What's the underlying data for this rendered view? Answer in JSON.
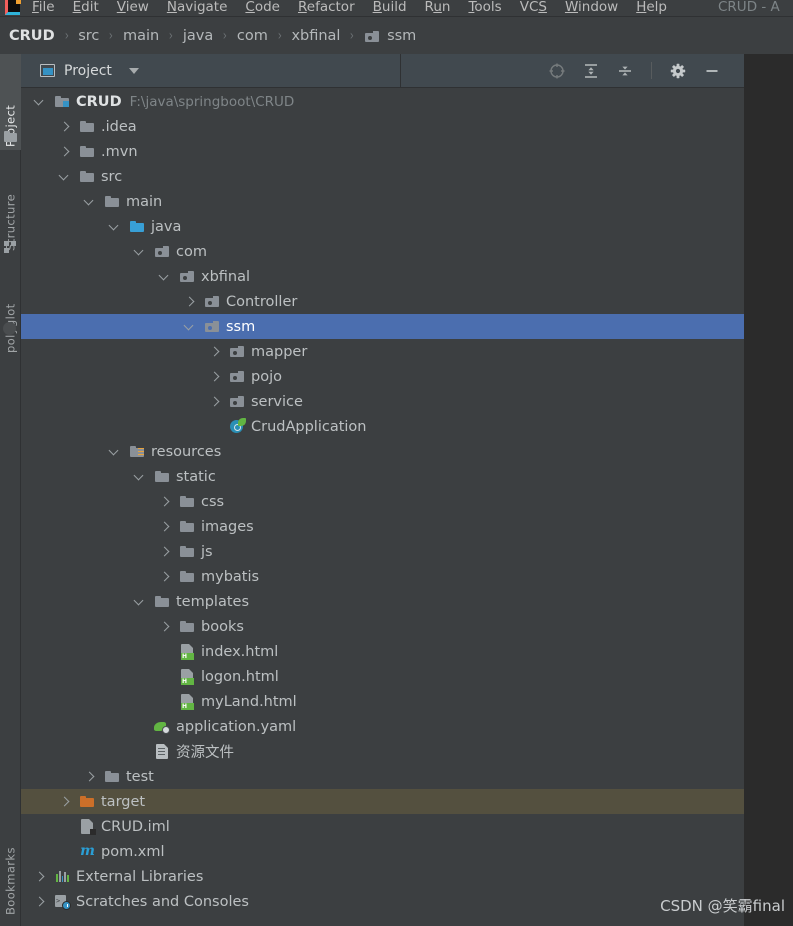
{
  "window": {
    "title": "CRUD - A",
    "app_icon": "intellij-idea-logo"
  },
  "menubar": {
    "items": [
      {
        "label": "File",
        "mnemonic": "F"
      },
      {
        "label": "Edit",
        "mnemonic": "E"
      },
      {
        "label": "View",
        "mnemonic": "V"
      },
      {
        "label": "Navigate",
        "mnemonic": "N"
      },
      {
        "label": "Code",
        "mnemonic": "C"
      },
      {
        "label": "Refactor",
        "mnemonic": "R"
      },
      {
        "label": "Build",
        "mnemonic": "B"
      },
      {
        "label": "Run",
        "mnemonic": "u"
      },
      {
        "label": "Tools",
        "mnemonic": "T"
      },
      {
        "label": "VCS",
        "mnemonic": "S"
      },
      {
        "label": "Window",
        "mnemonic": "W"
      },
      {
        "label": "Help",
        "mnemonic": "H"
      }
    ]
  },
  "breadcrumb": {
    "separator": "›",
    "items": [
      {
        "label": "CRUD",
        "icon": null
      },
      {
        "label": "src",
        "icon": null
      },
      {
        "label": "main",
        "icon": null
      },
      {
        "label": "java",
        "icon": null
      },
      {
        "label": "com",
        "icon": null
      },
      {
        "label": "xbfinal",
        "icon": null
      },
      {
        "label": "ssm",
        "icon": "package-icon"
      }
    ]
  },
  "toolstrip": {
    "left": [
      {
        "label": "Project",
        "icon": "folder-icon",
        "active": true
      },
      {
        "label": "Structure",
        "icon": "structure-icon",
        "active": false
      },
      {
        "label": "polyglot",
        "icon": "polyglot-icon",
        "active": false
      }
    ],
    "bottom": [
      {
        "label": "Bookmarks",
        "icon": "bookmarks-icon",
        "active": false
      }
    ]
  },
  "project_panel": {
    "title": "Project",
    "dropdown_icon": "chevron-down-icon",
    "view_icon": "tool-window-icon",
    "actions": [
      {
        "name": "select-opened-file",
        "icon": "locate-target-icon",
        "tooltip": "Select Opened File"
      },
      {
        "name": "expand-all",
        "icon": "expand-all-icon",
        "tooltip": "Expand All"
      },
      {
        "name": "collapse-all",
        "icon": "collapse-all-icon",
        "tooltip": "Collapse All"
      },
      {
        "name": "settings",
        "icon": "gear-icon",
        "tooltip": "Options"
      },
      {
        "name": "hide",
        "icon": "minimize-icon",
        "tooltip": "Hide"
      }
    ]
  },
  "tree": {
    "nodes": [
      {
        "label": "CRUD",
        "sublabel": "F:\\java\\springboot\\CRUD",
        "depth": 0,
        "arrow": "down",
        "icon": "module-icon",
        "bold": true,
        "state": "normal"
      },
      {
        "label": ".idea",
        "sublabel": "",
        "depth": 1,
        "arrow": "right",
        "icon": "folder-gray-icon",
        "bold": false,
        "state": "normal"
      },
      {
        "label": ".mvn",
        "sublabel": "",
        "depth": 1,
        "arrow": "right",
        "icon": "folder-gray-icon",
        "bold": false,
        "state": "normal"
      },
      {
        "label": "src",
        "sublabel": "",
        "depth": 1,
        "arrow": "down",
        "icon": "folder-gray-icon",
        "bold": false,
        "state": "normal"
      },
      {
        "label": "main",
        "sublabel": "",
        "depth": 2,
        "arrow": "down",
        "icon": "folder-gray-icon",
        "bold": false,
        "state": "normal"
      },
      {
        "label": "java",
        "sublabel": "",
        "depth": 3,
        "arrow": "down",
        "icon": "folder-source-icon",
        "bold": false,
        "state": "normal"
      },
      {
        "label": "com",
        "sublabel": "",
        "depth": 4,
        "arrow": "down",
        "icon": "package-icon",
        "bold": false,
        "state": "normal"
      },
      {
        "label": "xbfinal",
        "sublabel": "",
        "depth": 5,
        "arrow": "down",
        "icon": "package-icon",
        "bold": false,
        "state": "normal"
      },
      {
        "label": "Controller",
        "sublabel": "",
        "depth": 6,
        "arrow": "right",
        "icon": "package-icon",
        "bold": false,
        "state": "normal"
      },
      {
        "label": "ssm",
        "sublabel": "",
        "depth": 6,
        "arrow": "down",
        "icon": "package-icon",
        "bold": false,
        "state": "selected"
      },
      {
        "label": "mapper",
        "sublabel": "",
        "depth": 7,
        "arrow": "right",
        "icon": "package-icon",
        "bold": false,
        "state": "normal"
      },
      {
        "label": "pojo",
        "sublabel": "",
        "depth": 7,
        "arrow": "right",
        "icon": "package-icon",
        "bold": false,
        "state": "normal"
      },
      {
        "label": "service",
        "sublabel": "",
        "depth": 7,
        "arrow": "right",
        "icon": "package-icon",
        "bold": false,
        "state": "normal"
      },
      {
        "label": "CrudApplication",
        "sublabel": "",
        "depth": 7,
        "arrow": "none",
        "icon": "spring-boot-class-icon",
        "bold": false,
        "state": "normal"
      },
      {
        "label": "resources",
        "sublabel": "",
        "depth": 3,
        "arrow": "down",
        "icon": "folder-resources-icon",
        "bold": false,
        "state": "normal"
      },
      {
        "label": "static",
        "sublabel": "",
        "depth": 4,
        "arrow": "down",
        "icon": "folder-gray-icon",
        "bold": false,
        "state": "normal"
      },
      {
        "label": "css",
        "sublabel": "",
        "depth": 5,
        "arrow": "right",
        "icon": "folder-gray-icon",
        "bold": false,
        "state": "normal"
      },
      {
        "label": "images",
        "sublabel": "",
        "depth": 5,
        "arrow": "right",
        "icon": "folder-gray-icon",
        "bold": false,
        "state": "normal"
      },
      {
        "label": "js",
        "sublabel": "",
        "depth": 5,
        "arrow": "right",
        "icon": "folder-gray-icon",
        "bold": false,
        "state": "normal"
      },
      {
        "label": "mybatis",
        "sublabel": "",
        "depth": 5,
        "arrow": "right",
        "icon": "folder-gray-icon",
        "bold": false,
        "state": "normal"
      },
      {
        "label": "templates",
        "sublabel": "",
        "depth": 4,
        "arrow": "down",
        "icon": "folder-gray-icon",
        "bold": false,
        "state": "normal"
      },
      {
        "label": "books",
        "sublabel": "",
        "depth": 5,
        "arrow": "right",
        "icon": "folder-gray-icon",
        "bold": false,
        "state": "normal"
      },
      {
        "label": "index.html",
        "sublabel": "",
        "depth": 5,
        "arrow": "none",
        "icon": "html-file-icon",
        "bold": false,
        "state": "normal"
      },
      {
        "label": "logon.html",
        "sublabel": "",
        "depth": 5,
        "arrow": "none",
        "icon": "html-file-icon",
        "bold": false,
        "state": "normal"
      },
      {
        "label": "myLand.html",
        "sublabel": "",
        "depth": 5,
        "arrow": "none",
        "icon": "html-file-icon",
        "bold": false,
        "state": "normal"
      },
      {
        "label": "application.yaml",
        "sublabel": "",
        "depth": 4,
        "arrow": "none",
        "icon": "spring-yaml-icon",
        "bold": false,
        "state": "normal"
      },
      {
        "label": "资源文件",
        "sublabel": "",
        "depth": 4,
        "arrow": "none",
        "icon": "file-icon",
        "bold": false,
        "state": "normal"
      },
      {
        "label": "test",
        "sublabel": "",
        "depth": 2,
        "arrow": "right",
        "icon": "folder-gray-icon",
        "bold": false,
        "state": "normal"
      },
      {
        "label": "target",
        "sublabel": "",
        "depth": 1,
        "arrow": "right",
        "icon": "folder-excluded-icon",
        "bold": false,
        "state": "highlighted"
      },
      {
        "label": "CRUD.iml",
        "sublabel": "",
        "depth": 1,
        "arrow": "none",
        "icon": "iml-file-icon",
        "bold": false,
        "state": "normal"
      },
      {
        "label": "pom.xml",
        "sublabel": "",
        "depth": 1,
        "arrow": "none",
        "icon": "maven-file-icon",
        "bold": false,
        "state": "normal"
      },
      {
        "label": "External Libraries",
        "sublabel": "",
        "depth": 0,
        "arrow": "right",
        "icon": "libraries-icon",
        "bold": false,
        "state": "normal"
      },
      {
        "label": "Scratches and Consoles",
        "sublabel": "",
        "depth": 0,
        "arrow": "right",
        "icon": "scratches-icon",
        "bold": false,
        "state": "normal"
      }
    ]
  },
  "watermark": {
    "text": "CSDN @笑霸final"
  },
  "colors": {
    "panel_bg": "#3c3f41",
    "editor_bg": "#2b2b2b",
    "selection_blue": "#4b6eaf",
    "excluded_highlight": "#54503f",
    "text": "#bcc0c2",
    "muted_text": "#7f8588",
    "folder_gray": "#8a9097",
    "folder_source_teal": "#389fd6",
    "folder_excluded_orange": "#cc6f29",
    "spring_green": "#62b543",
    "maven_blue": "#2a9fd6"
  }
}
